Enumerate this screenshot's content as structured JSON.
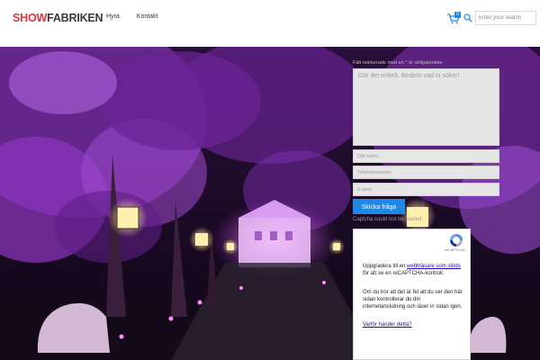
{
  "header": {
    "logo_show": "SHOW",
    "logo_fabriken": "FABRIKEN",
    "nav": [
      "Hyra",
      "Kontakt"
    ],
    "cart_count": "0",
    "search_placeholder": "Enter your search"
  },
  "form": {
    "required_note": "Fält märkerade med en * är obligatoriska",
    "message_placeholder": "Gör det enkelt. Beskriv vad ni söker!",
    "name_placeholder": "Ditt namn",
    "phone_placeholder": "Telefonnummer",
    "email_placeholder": "E-post",
    "submit_label": "Skicka fråga",
    "captcha_error": "Captcha could not be loaded"
  },
  "captcha": {
    "brand": "reCAPTCHA",
    "p1_before": "Uppgradera till en ",
    "p1_link": "webbläsare som stöds",
    "p1_after": " för att se en reCAPTCHA-kontroll.",
    "p2": "Om du tror att det är fel att du ser den här sidan kontrollerar du din internetanslutning och läser in sidan igen.",
    "why_link": "Varför händer detta?"
  },
  "colors": {
    "brand_red": "#e8313d",
    "accent_blue": "#1e88e5"
  }
}
